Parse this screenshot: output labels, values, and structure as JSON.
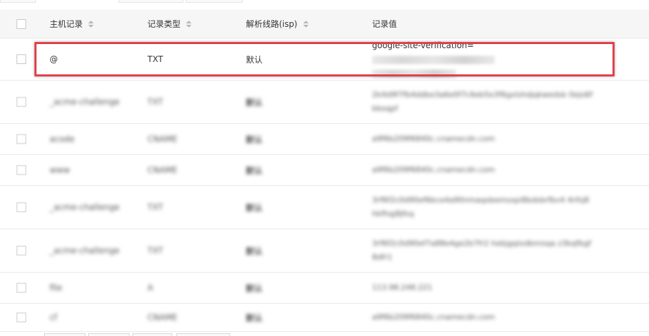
{
  "header": {
    "host_label": "主机记录",
    "type_label": "记录类型",
    "line_label": "解析线路(isp)",
    "value_label": "记录值"
  },
  "highlighted_record": {
    "host": "@",
    "type": "TXT",
    "line": "默认",
    "value_prefix": "google-site-verification="
  },
  "blurred_records": [
    {
      "host": "_acme-challenge",
      "type": "TXT",
      "line": "默认",
      "value": "2k4d9f7fb4ddbe3a6e0f7c6eb5e3f6gxlshdjqkwedsk 0ejo6fbkoqpf"
    },
    {
      "host": "acode",
      "type": "CNAME",
      "line": "默认",
      "value": "a9f6b209f6840c.cnamecdn.com"
    },
    {
      "host": "www",
      "type": "CNAME",
      "line": "默认",
      "value": "a9f6b209f6840c.cnamecdn.com"
    },
    {
      "host": "_acme-challenge",
      "type": "TXT",
      "line": "默认",
      "value": "3rf6f2c0d90ef6bce4a90nmaqobemsxpi8bdsbrfbv4 4rlhj8hkfhqj8jfsq"
    },
    {
      "host": "_acme-challenge",
      "type": "TXT",
      "line": "默认",
      "value": "3rf6f2c0d90ef7a88e4ge2b7fr2 hebjgqlxdbnroqa z3bqfbgf8dfr1"
    },
    {
      "host": "file",
      "type": "A",
      "line": "默认",
      "value": "113.98.248.221"
    },
    {
      "host": "cf",
      "type": "CNAME",
      "line": "默认",
      "value": "a9f6b209f6840c.cnamecdn.com"
    }
  ],
  "colors": {
    "highlight_border": "#e0404a",
    "header_bg": "#f6f6f6",
    "row_border": "#e9e9e9"
  }
}
